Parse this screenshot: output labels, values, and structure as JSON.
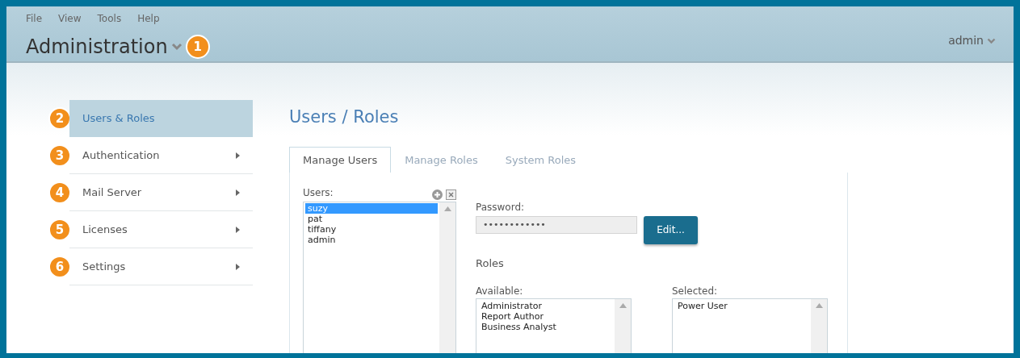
{
  "menu": [
    "File",
    "View",
    "Tools",
    "Help"
  ],
  "header": {
    "title": "Administration",
    "callout": "1",
    "user": "admin"
  },
  "sidebar": {
    "items": [
      {
        "label": "Users & Roles",
        "callout": "2",
        "selected": true
      },
      {
        "label": "Authentication",
        "callout": "3",
        "selected": false
      },
      {
        "label": "Mail Server",
        "callout": "4",
        "selected": false
      },
      {
        "label": "Licenses",
        "callout": "5",
        "selected": false
      },
      {
        "label": "Settings",
        "callout": "6",
        "selected": false
      }
    ]
  },
  "page_title": "Users / Roles",
  "tabs": [
    {
      "label": "Manage Users",
      "selected": true
    },
    {
      "label": "Manage Roles",
      "selected": false
    },
    {
      "label": "System Roles",
      "selected": false
    }
  ],
  "users": {
    "label": "Users:",
    "items": [
      {
        "name": "suzy",
        "selected": true
      },
      {
        "name": "pat",
        "selected": false
      },
      {
        "name": "tiffany",
        "selected": false
      },
      {
        "name": "admin",
        "selected": false
      }
    ]
  },
  "password": {
    "label": "Password:",
    "value": "••••••••••••"
  },
  "edit_button": "Edit...",
  "roles": {
    "heading": "Roles",
    "available": {
      "label": "Available:",
      "items": [
        "Administrator",
        "Report Author",
        "Business Analyst"
      ]
    },
    "selected": {
      "label": "Selected:",
      "items": [
        "Power User"
      ]
    }
  }
}
